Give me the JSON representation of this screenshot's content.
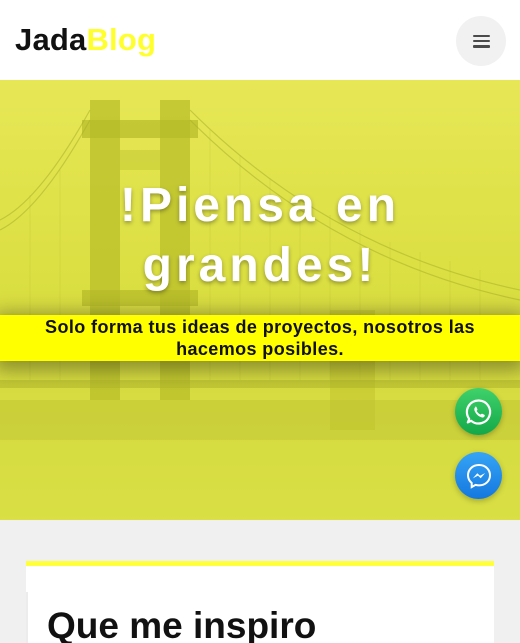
{
  "brand": {
    "part1": "Jada",
    "part2": "Blog"
  },
  "nav": {
    "menu_icon": "hamburger-icon"
  },
  "hero": {
    "title_line1": "!Piensa en",
    "title_line2": "grandes!",
    "subtitle_line1": "Solo forma tus ideas de proyectos, nosotros las",
    "subtitle_line2": "hacemos posibles."
  },
  "floating_buttons": [
    {
      "icon": "whatsapp-icon",
      "color": "#25d366"
    },
    {
      "icon": "messenger-icon",
      "color": "#1e88e5"
    }
  ],
  "section": {
    "title": "Que me inspiro"
  },
  "colors": {
    "accent": "#ffff00",
    "brand_highlight": "#ffff2e"
  }
}
